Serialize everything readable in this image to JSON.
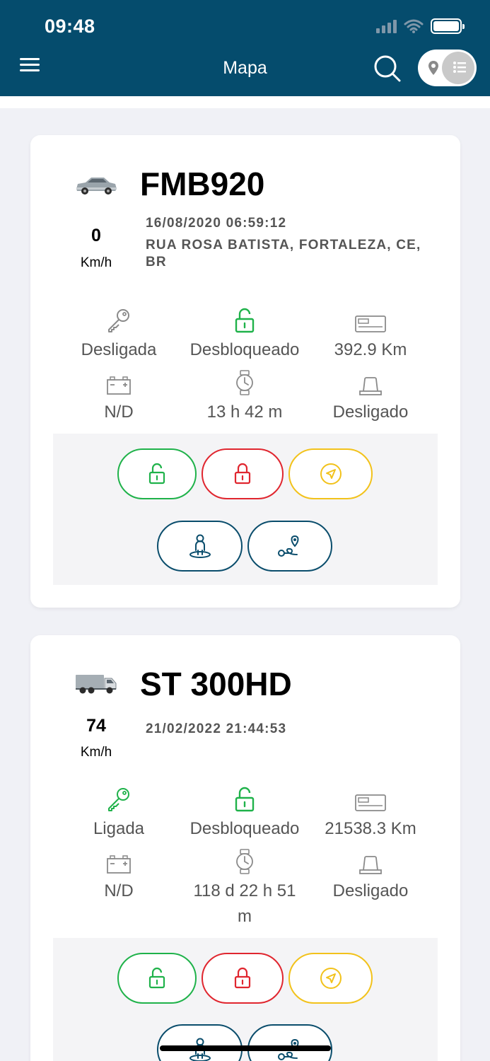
{
  "status_bar": {
    "time": "09:48"
  },
  "header": {
    "title": "Mapa",
    "view_toggle_state": "list"
  },
  "colors": {
    "header": "#054c6d",
    "green": "#1fb24a",
    "red": "#e0262f",
    "yellow": "#f2c21b",
    "blue": "#0a4d6c"
  },
  "vehicles": [
    {
      "vehicle_type": "car",
      "plate": "FMB920",
      "speed": "0",
      "speed_unit": "Km/h",
      "datetime": "16/08/2020 06:59:12",
      "address": "RUA ROSA BATISTA, FORTALEZA, CE, BR",
      "ignition": "Desligada",
      "ignition_color": "#8a8a8a",
      "lock_status": "Desbloqueado",
      "odometer": "392.9 Km",
      "battery": "N/D",
      "duration": "13 h 42 m",
      "siren": "Desligado"
    },
    {
      "vehicle_type": "truck",
      "plate": "ST 300HD",
      "speed": "74",
      "speed_unit": "Km/h",
      "datetime": "21/02/2022 21:44:53",
      "ignition": "Ligada",
      "ignition_color": "#1fb24a",
      "lock_status": "Desbloqueado",
      "odometer": "21538.3 Km",
      "battery": "N/D",
      "duration": "118 d 22 h 51 m",
      "siren": "Desligado"
    }
  ]
}
